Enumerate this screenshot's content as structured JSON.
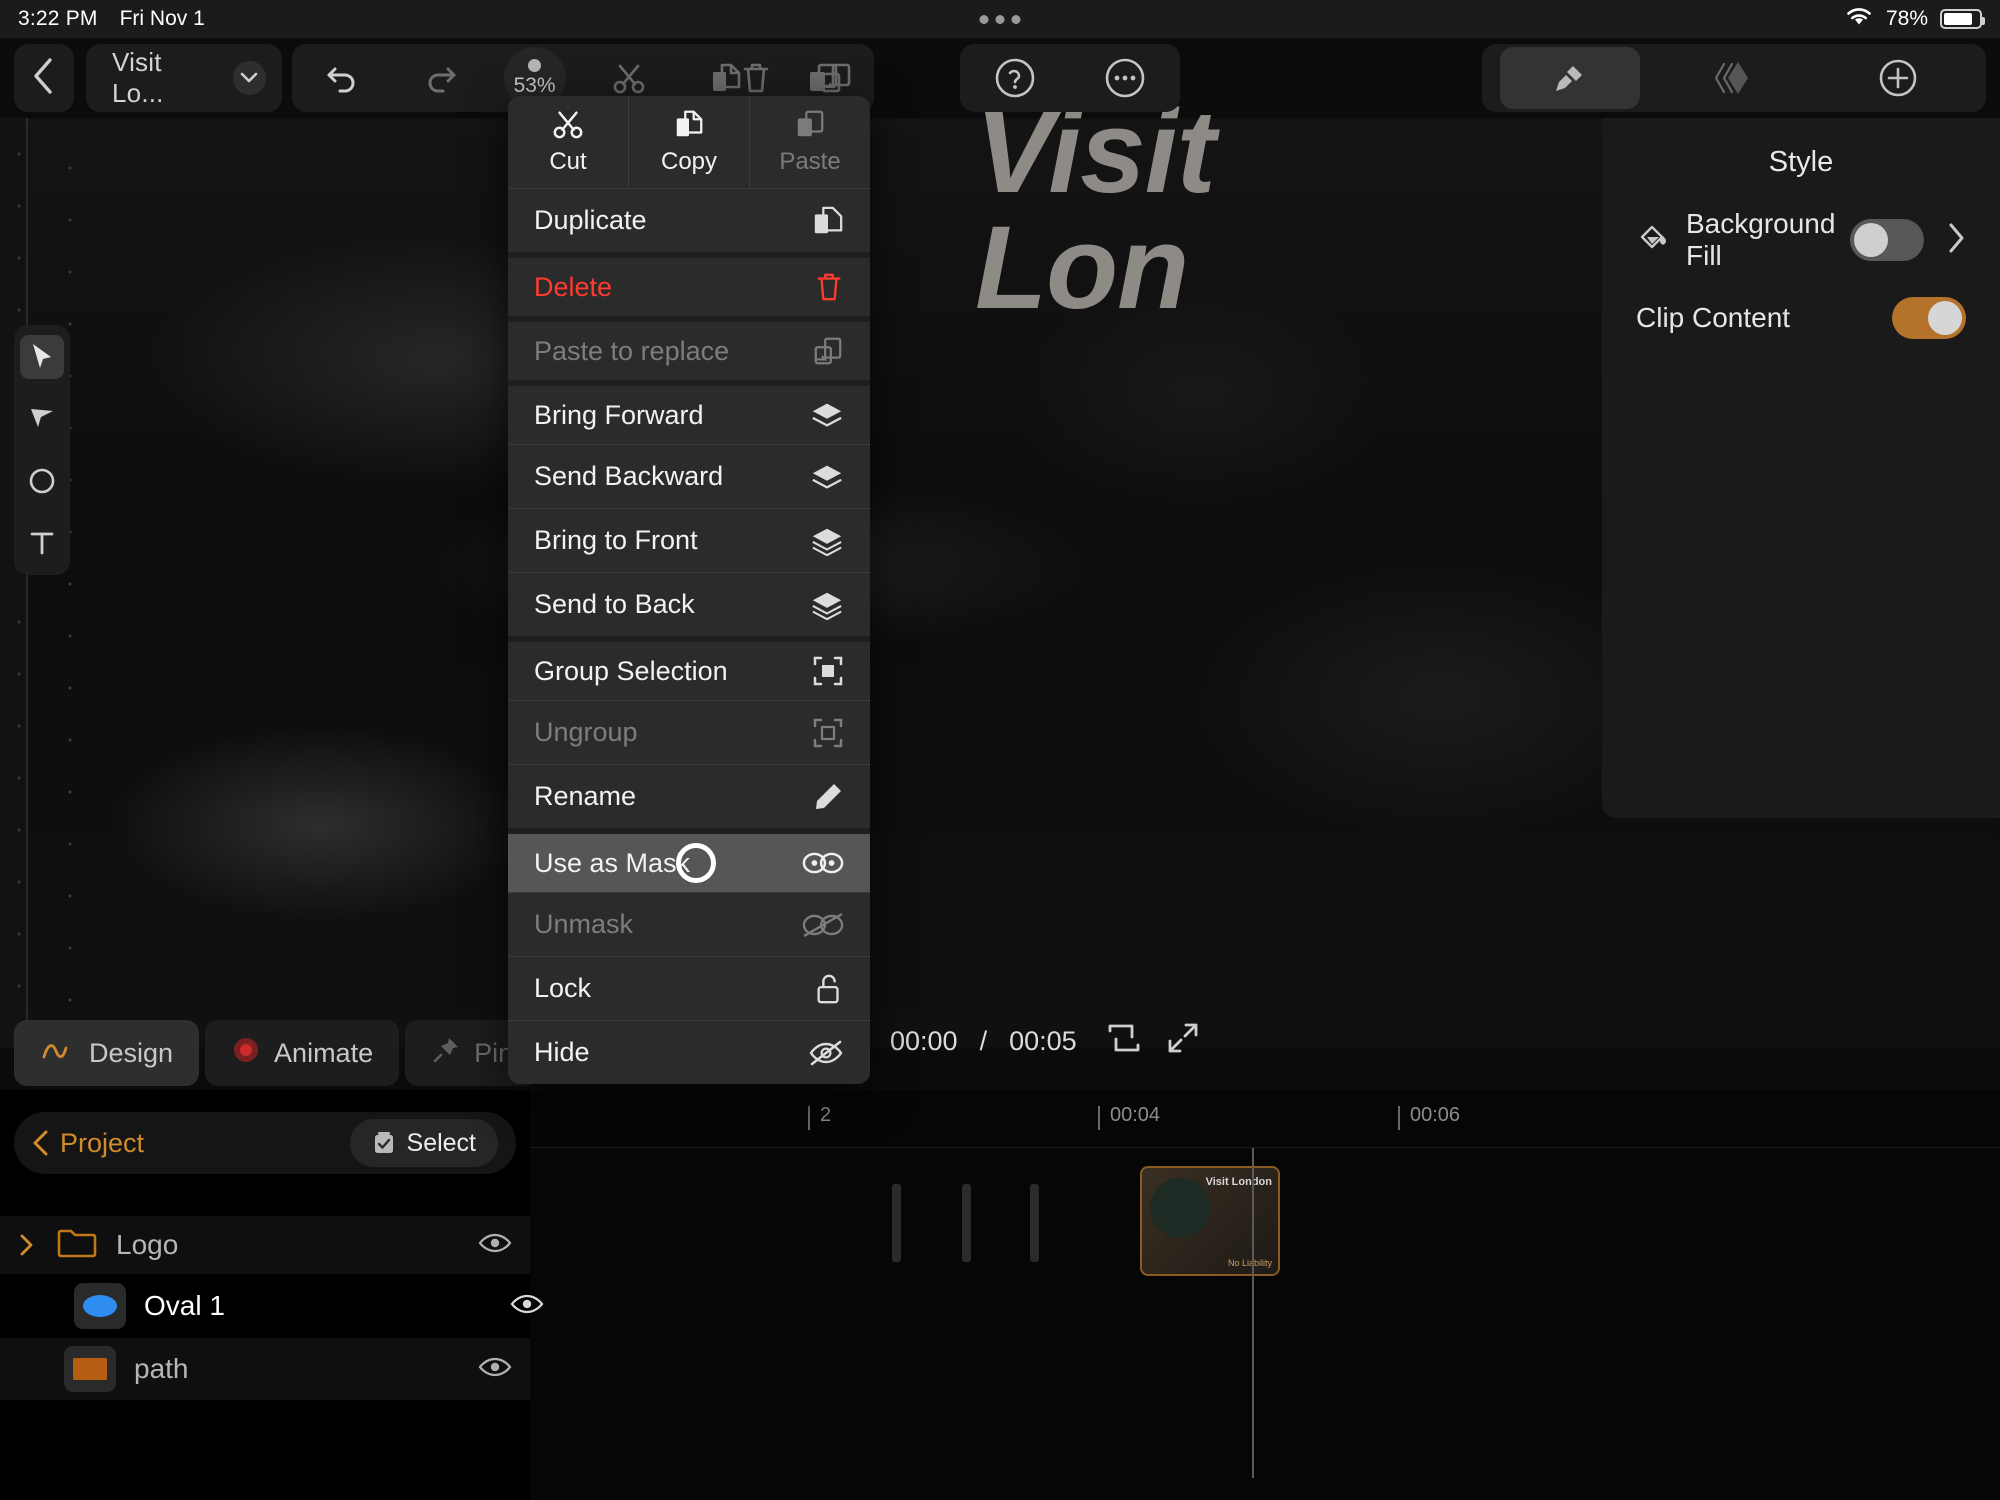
{
  "status_bar": {
    "time": "3:22 PM",
    "date": "Fri Nov 1",
    "battery_percent": "78%",
    "wifi_icon": "wifi-icon",
    "battery_icon": "battery-icon"
  },
  "toolbar": {
    "back_icon": "chevron-left-icon",
    "document_title": "Visit Lo...",
    "title_chevron_icon": "chevron-down-icon",
    "undo_icon": "undo-icon",
    "redo_icon": "redo-icon",
    "zoom_level": "53%",
    "cut_icon": "scissors-icon",
    "copy_icon": "copy-icon",
    "paste_icon": "paste-icon",
    "delete_icon": "trash-icon",
    "paste_replace_icon": "paste-replace-icon",
    "help_icon": "question-circle-icon",
    "more_icon": "ellipsis-circle-icon",
    "style_tab_icon": "paint-roller-icon",
    "layers_tab_icon": "layers-diamond-icon",
    "add_icon": "plus-circle-icon"
  },
  "tool_rail": {
    "items": [
      {
        "name": "select-tool",
        "icon": "cursor-arrow-icon",
        "selected": true
      },
      {
        "name": "direct-select-tool",
        "icon": "cursor-filled-icon",
        "selected": false
      },
      {
        "name": "ellipse-tool",
        "icon": "circle-icon",
        "selected": false
      },
      {
        "name": "text-tool",
        "icon": "text-t-icon",
        "selected": false
      }
    ]
  },
  "canvas": {
    "hero_line_1": "Visit",
    "hero_line_2": "Lon"
  },
  "context_menu": {
    "top_actions": [
      {
        "label": "Cut",
        "icon": "scissors-icon",
        "enabled": true
      },
      {
        "label": "Copy",
        "icon": "copy-icon",
        "enabled": true
      },
      {
        "label": "Paste",
        "icon": "paste-icon",
        "enabled": false
      }
    ],
    "items": [
      {
        "label": "Duplicate",
        "icon": "duplicate-icon",
        "enabled": true,
        "danger": false,
        "highlighted": false,
        "separator_above": false
      },
      {
        "label": "Delete",
        "icon": "trash-icon",
        "enabled": true,
        "danger": true,
        "highlighted": false,
        "separator_above": true
      },
      {
        "label": "Paste to replace",
        "icon": "paste-replace-icon",
        "enabled": false,
        "danger": false,
        "highlighted": false,
        "separator_above": true
      },
      {
        "label": "Bring Forward",
        "icon": "layers-icon",
        "enabled": true,
        "danger": false,
        "highlighted": false,
        "separator_above": true
      },
      {
        "label": "Send Backward",
        "icon": "layers-icon",
        "enabled": true,
        "danger": false,
        "highlighted": false,
        "separator_above": false
      },
      {
        "label": "Bring to Front",
        "icon": "layers-icon",
        "enabled": true,
        "danger": false,
        "highlighted": false,
        "separator_above": false
      },
      {
        "label": "Send to Back",
        "icon": "layers-icon",
        "enabled": true,
        "danger": false,
        "highlighted": false,
        "separator_above": false
      },
      {
        "label": "Group Selection",
        "icon": "group-icon",
        "enabled": true,
        "danger": false,
        "highlighted": false,
        "separator_above": true
      },
      {
        "label": "Ungroup",
        "icon": "ungroup-icon",
        "enabled": false,
        "danger": false,
        "highlighted": false,
        "separator_above": false
      },
      {
        "label": "Rename",
        "icon": "pencil-icon",
        "enabled": true,
        "danger": false,
        "highlighted": false,
        "separator_above": false
      },
      {
        "label": "Use as Mask",
        "icon": "mask-icon",
        "enabled": true,
        "danger": false,
        "highlighted": true,
        "separator_above": true
      },
      {
        "label": "Unmask",
        "icon": "unmask-icon",
        "enabled": false,
        "danger": false,
        "highlighted": false,
        "separator_above": false
      },
      {
        "label": "Lock",
        "icon": "unlock-icon",
        "enabled": true,
        "danger": false,
        "highlighted": false,
        "separator_above": false
      },
      {
        "label": "Hide",
        "icon": "eye-slash-icon",
        "enabled": true,
        "danger": false,
        "highlighted": false,
        "separator_above": false
      }
    ]
  },
  "style_panel": {
    "title": "Style",
    "background_fill": {
      "label": "Background Fill",
      "icon": "paint-bucket-icon",
      "toggle_on": false,
      "disclosure_icon": "chevron-right-icon"
    },
    "clip_content": {
      "label": "Clip Content",
      "toggle_on": true
    }
  },
  "mode_bar": {
    "tabs": [
      {
        "label": "Design",
        "icon": "squiggle-icon",
        "active": true,
        "enabled": true
      },
      {
        "label": "Animate",
        "icon": "record-dot-icon",
        "active": false,
        "enabled": true
      },
      {
        "label": "Pin",
        "icon": "pin-icon",
        "active": false,
        "enabled": false
      }
    ],
    "add_icon": "diamond-plus-icon"
  },
  "playback": {
    "current_time": "00:00",
    "separator": "/",
    "total_time": "00:05",
    "loop_icon": "loop-icon",
    "fullscreen_icon": "expand-icon"
  },
  "layers_panel": {
    "back_label": "Project",
    "back_icon": "chevron-left-icon",
    "select_label": "Select",
    "select_icon": "checkbox-icon",
    "rows": [
      {
        "name": "Logo",
        "type": "folder",
        "icon": "folder-icon",
        "expand_icon": "chevron-right-icon",
        "indent": 0,
        "selected": false,
        "eye_icon": "eye-icon",
        "swatch": "#c07818"
      },
      {
        "name": "Oval 1",
        "type": "shape",
        "icon": "oval-icon",
        "expand_icon": "",
        "indent": 1,
        "selected": true,
        "eye_icon": "eye-icon",
        "swatch": "#2f8cf0"
      },
      {
        "name": "path",
        "type": "shape",
        "icon": "rect-icon",
        "expand_icon": "",
        "indent": 1,
        "selected": false,
        "eye_icon": "eye-icon",
        "swatch": "#b35c12"
      }
    ]
  },
  "timeline": {
    "ticks": [
      "2",
      "00:04",
      "00:06"
    ],
    "clip_title": "Visit London",
    "clip_subtitle": "No Liability"
  },
  "colors": {
    "accent_orange": "#d08b2a",
    "danger_red": "#ff3b30",
    "toggle_on": "#b5722a",
    "blue_shape": "#2f8cf0"
  }
}
